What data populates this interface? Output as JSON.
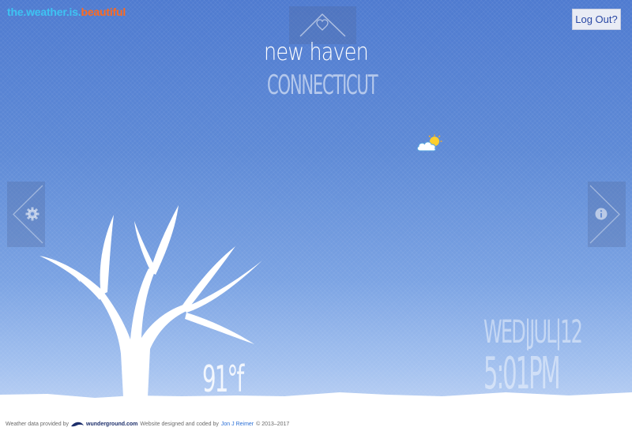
{
  "brand": {
    "part1": "the.weather.is.",
    "part2": "beautiful"
  },
  "header": {
    "logout_label": "Log Out?",
    "home_icon": "house-heart-icon"
  },
  "location": {
    "city": "new haven",
    "state": "CONNECTICUT"
  },
  "condition": {
    "icon": "partly-cloudy-icon"
  },
  "nav": {
    "left_icon": "gear-icon",
    "right_icon": "info-icon"
  },
  "weather": {
    "temperature": "91°f"
  },
  "datetime": {
    "date": "WED|JUL|12",
    "time": "5:01PM"
  },
  "footer": {
    "prefix": "Weather data provided by",
    "provider": "wunderground.com",
    "middle": "Website designed and coded by",
    "author": "Jon J Reimer",
    "copyright": "© 2013–2017"
  },
  "colors": {
    "brand_blue": "#3ec3f2",
    "brand_orange": "#ff6a1f",
    "sky_top": "#4f7bd0",
    "sky_bottom": "#c9daf6"
  }
}
